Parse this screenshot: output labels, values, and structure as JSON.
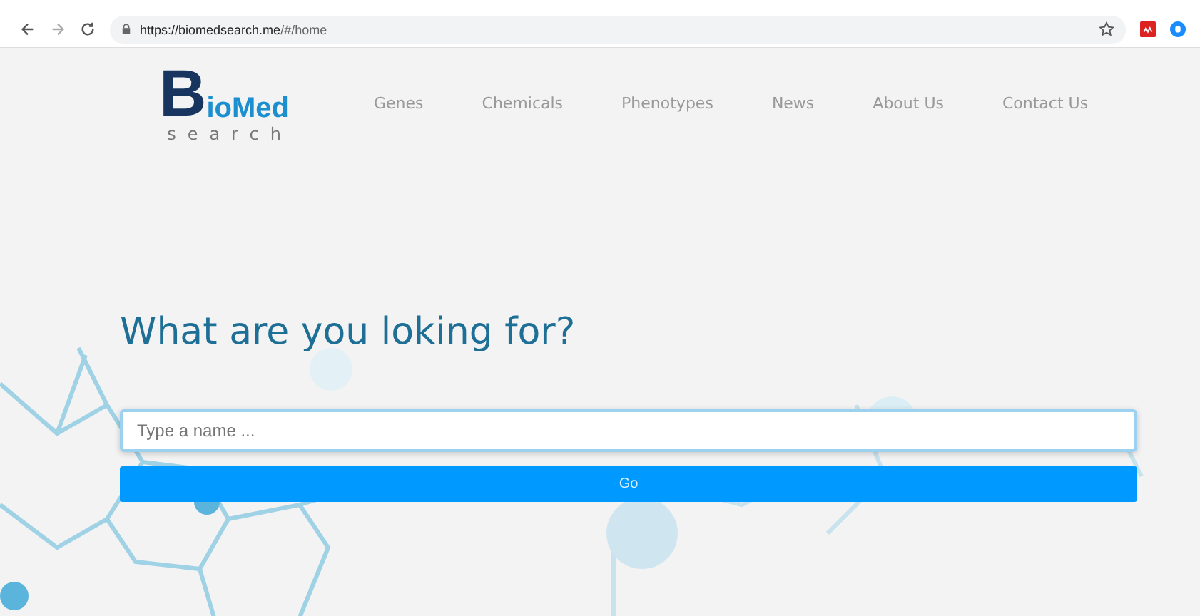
{
  "browser": {
    "url_host": "https://biomedsearch.me",
    "url_path": "/#/home"
  },
  "logo": {
    "initial": "B",
    "rest": "ioMed",
    "sub": "search"
  },
  "nav": [
    {
      "label": "Genes"
    },
    {
      "label": "Chemicals"
    },
    {
      "label": "Phenotypes"
    },
    {
      "label": "News"
    },
    {
      "label": "About Us"
    },
    {
      "label": "Contact Us"
    }
  ],
  "heading": "What are you loking for?",
  "search": {
    "placeholder": "Type a name ..."
  },
  "go_button": "Go"
}
